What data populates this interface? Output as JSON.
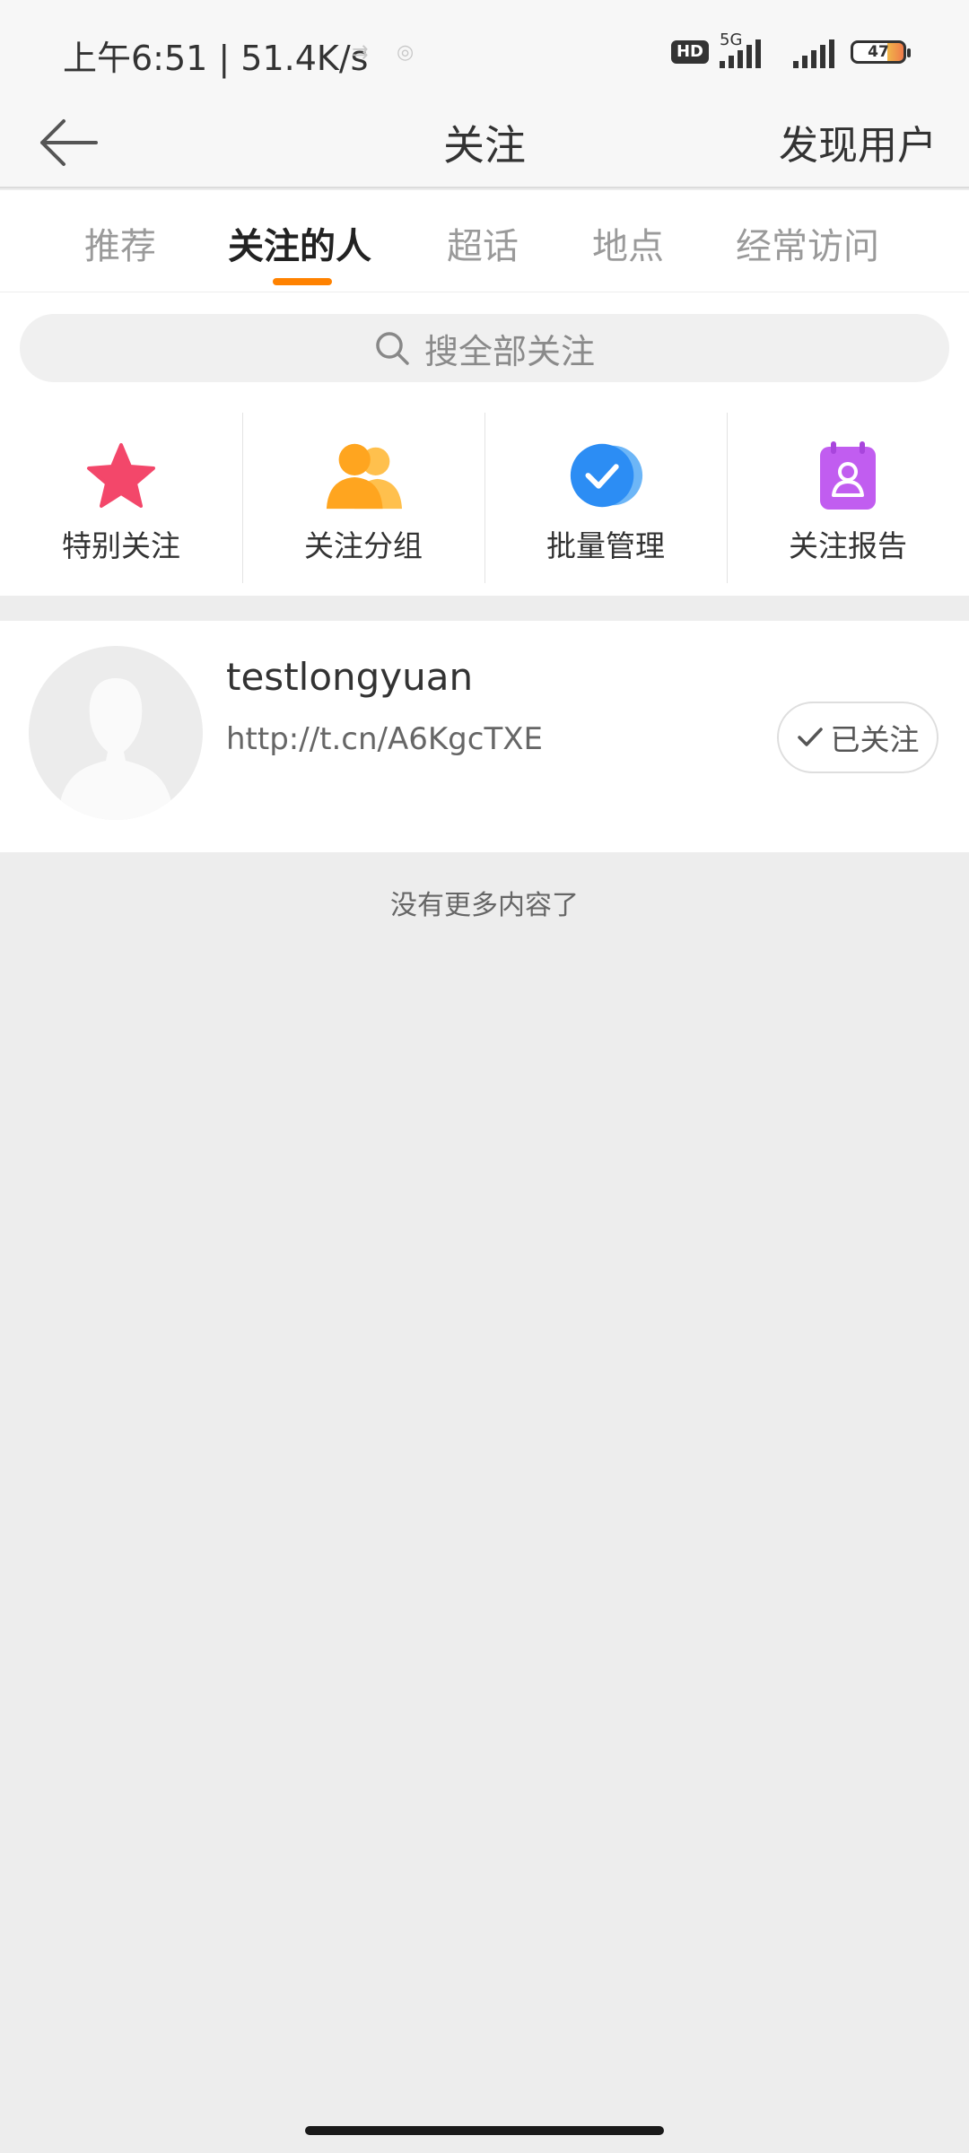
{
  "status_bar": {
    "time": "上午6:51 | 51.4K/s",
    "hd": "HD",
    "network": "5G",
    "battery": "47"
  },
  "nav": {
    "title": "关注",
    "action": "发现用户"
  },
  "tabs": [
    {
      "label": "推荐",
      "active": false
    },
    {
      "label": "关注的人",
      "active": true
    },
    {
      "label": "超话",
      "active": false
    },
    {
      "label": "地点",
      "active": false
    },
    {
      "label": "经常访问",
      "active": false
    }
  ],
  "search": {
    "placeholder": "搜全部关注"
  },
  "quick_actions": [
    {
      "label": "特别关注",
      "icon": "star-icon",
      "color": "#f3476a"
    },
    {
      "label": "关注分组",
      "icon": "group-icon",
      "color": "#ffa51f"
    },
    {
      "label": "批量管理",
      "icon": "check-circle-icon",
      "color": "#2c8df4"
    },
    {
      "label": "关注报告",
      "icon": "report-icon",
      "color": "#c15df0"
    }
  ],
  "following_list": [
    {
      "name": "testlongyuan",
      "description": "http://t.cn/A6KgcTXE",
      "follow_status": "已关注"
    }
  ],
  "footer_text": "没有更多内容了",
  "colors": {
    "accent": "#ff8200",
    "background": "#ededed"
  }
}
